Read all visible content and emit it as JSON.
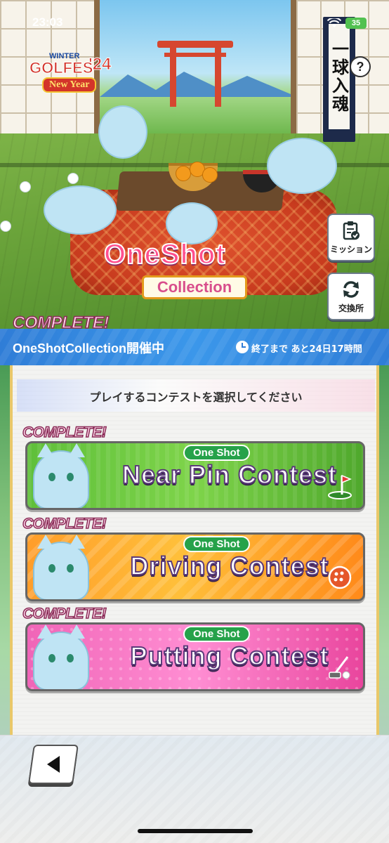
{
  "status_bar": {
    "time": "23:03",
    "battery": "35"
  },
  "event_logo": {
    "line1": "WINTER",
    "line2": "GOLFES",
    "year": "'24",
    "sub": "New Year"
  },
  "scroll_text": "一球入魂",
  "help_label": "?",
  "hero": {
    "title_line1": "OneShot",
    "title_line2": "Collection",
    "complete_badge": "COMPLETE!"
  },
  "side_buttons": {
    "mission_label": "ミッション",
    "exchange_label": "交換所"
  },
  "event_bar": {
    "name": "OneShotCollection開催中",
    "remaining": "終了まで あと24日17時間"
  },
  "panel": {
    "instruction": "プレイするコンテストを選択してください",
    "contests": [
      {
        "tag": "One Shot",
        "title": "Near Pin Contest",
        "badge": "COMPLETE!"
      },
      {
        "tag": "One Shot",
        "title": "Driving Contest",
        "badge": "COMPLETE!"
      },
      {
        "tag": "One Shot",
        "title": "Putting Contest",
        "badge": "COMPLETE!"
      }
    ]
  },
  "colors": {
    "event_bar": "#3b97ea",
    "near_pin": "#6cc940",
    "driving": "#ffae30",
    "putting": "#f270be",
    "complete_text": "#ffd6ea"
  },
  "icons": [
    "clipboard-check-icon",
    "refresh-icon",
    "back-arrow-icon",
    "clock-icon",
    "wifi-icon",
    "battery-icon",
    "flag-icon",
    "ball-icon",
    "putter-icon"
  ]
}
